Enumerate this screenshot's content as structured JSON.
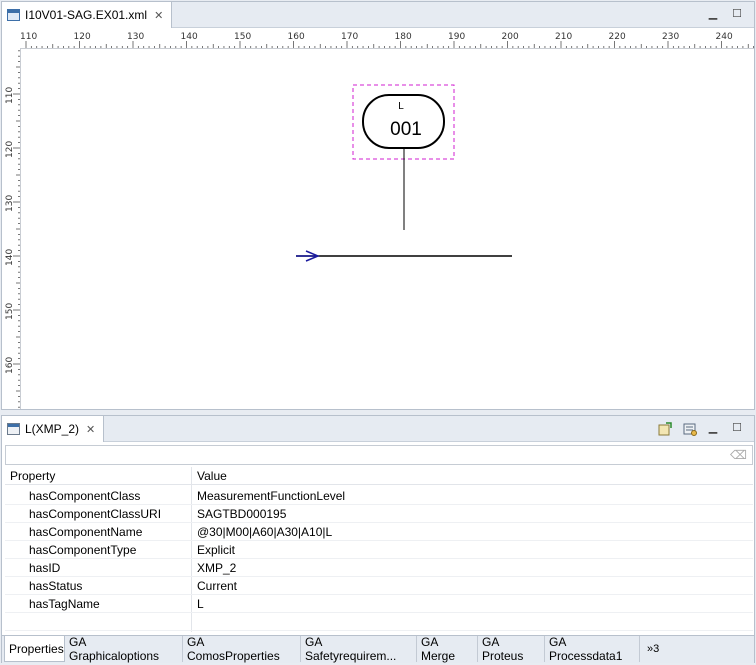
{
  "editor": {
    "tab_title": "I10V01-SAG.EX01.xml",
    "ruler_h_labels": [
      "110",
      "120",
      "130",
      "140",
      "150",
      "160",
      "170",
      "180",
      "190",
      "200",
      "210",
      "220",
      "230",
      "240"
    ],
    "ruler_v_labels": [
      "110",
      "120",
      "130",
      "140",
      "150",
      "160"
    ],
    "instrument": {
      "top_letter": "L",
      "number": "001"
    }
  },
  "properties_view": {
    "tab_title": "L(XMP_2)",
    "columns": {
      "property": "Property",
      "value": "Value"
    },
    "rows": [
      {
        "property": "hasComponentClass",
        "value": "MeasurementFunctionLevel"
      },
      {
        "property": "hasComponentClassURI",
        "value": "SAGTBD000195"
      },
      {
        "property": "hasComponentName",
        "value": "@30|M00|A60|A30|A10|L"
      },
      {
        "property": "hasComponentType",
        "value": "Explicit"
      },
      {
        "property": "hasID",
        "value": "XMP_2"
      },
      {
        "property": "hasStatus",
        "value": "Current"
      },
      {
        "property": "hasTagName",
        "value": "L"
      }
    ],
    "bottom_tabs": [
      "Properties",
      "GA Graphicaloptions",
      "GA ComosProperties",
      "GA Safetyrequirem...",
      "GA Merge",
      "GA Proteus",
      "GA Processdata1"
    ],
    "overflow": "»3"
  },
  "colors": {
    "selection": "#d11fd1",
    "arrow": "#1a1a9e"
  }
}
